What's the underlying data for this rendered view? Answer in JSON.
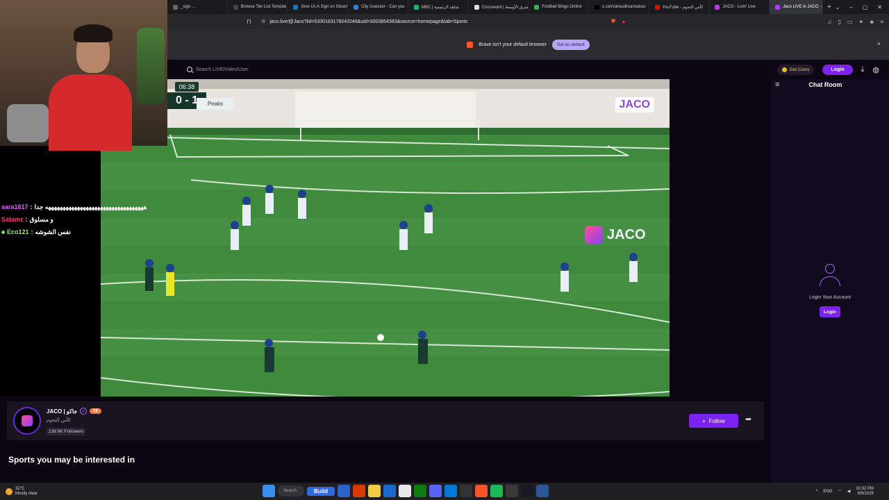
{
  "browser": {
    "tabs": [
      {
        "label": "_sign ...",
        "color": "#666"
      },
      {
        "label": "Browse Tier List Templat",
        "color": "#444"
      },
      {
        "label": "Give Us A Sign on Steam",
        "color": "#1b75bc"
      },
      {
        "label": "City Guesser - Can you",
        "color": "#3a7bd5"
      },
      {
        "label": "MBC | شاهد الرئيسية",
        "color": "#19b36b"
      },
      {
        "label": "Crossword | الشرق الأوسط",
        "color": "#ddd"
      },
      {
        "label": "Football Bingo Online",
        "color": "#2fb34a"
      },
      {
        "label": "x.com/alrasdksa/status/",
        "color": "#000"
      },
      {
        "label": "YouTube - كأس النجوم",
        "color": "#e00"
      },
      {
        "label": "JACO - Livin' Live",
        "color": "#b03cf0"
      },
      {
        "label": "Jaco LIVE in JACO",
        "color": "#b03cf0"
      }
    ],
    "new_tab": "+",
    "url": "jaco.live/@Jaco?lid=5330163178242048&uid=3003854383&source=homepage&tab=Sports",
    "info_message": "Brave isn't your default browser",
    "set_default": "Set as default",
    "info_close": "×"
  },
  "site": {
    "search_placeholder": "Search LIVE/Video/User",
    "get_coins": "Get Coins",
    "login": "Login"
  },
  "video": {
    "clock": "06:38",
    "score": "0 - 1",
    "team_left": "er",
    "team_right": "Peaks",
    "watermark": "JACO",
    "ad_logo": "JACO"
  },
  "stream_chat": [
    {
      "user": "sara1617",
      "message": "ههههههههههههههههههههههههههههههههههه جدا"
    },
    {
      "user": "Satamz",
      "message": "و مسلوق"
    },
    {
      "user": "Eco121",
      "message": "نفس الشوشه"
    }
  ],
  "channel": {
    "name": "JACO | جاكو",
    "level": "26",
    "subtitle": "كأس النجوم",
    "followers": "139.9K Followers",
    "follow": "Follow"
  },
  "sports_title": "Sports you may be interested in",
  "chat_room": {
    "title": "Chat Room",
    "login_text": "Login Your Account",
    "login_btn": "Login"
  },
  "taskbar": {
    "temp": "32°C",
    "weather": "Mostly clear",
    "search": "Search",
    "build": "Build",
    "lang": "ENG",
    "time": "10:32 PM",
    "date": "8/9/2025"
  }
}
